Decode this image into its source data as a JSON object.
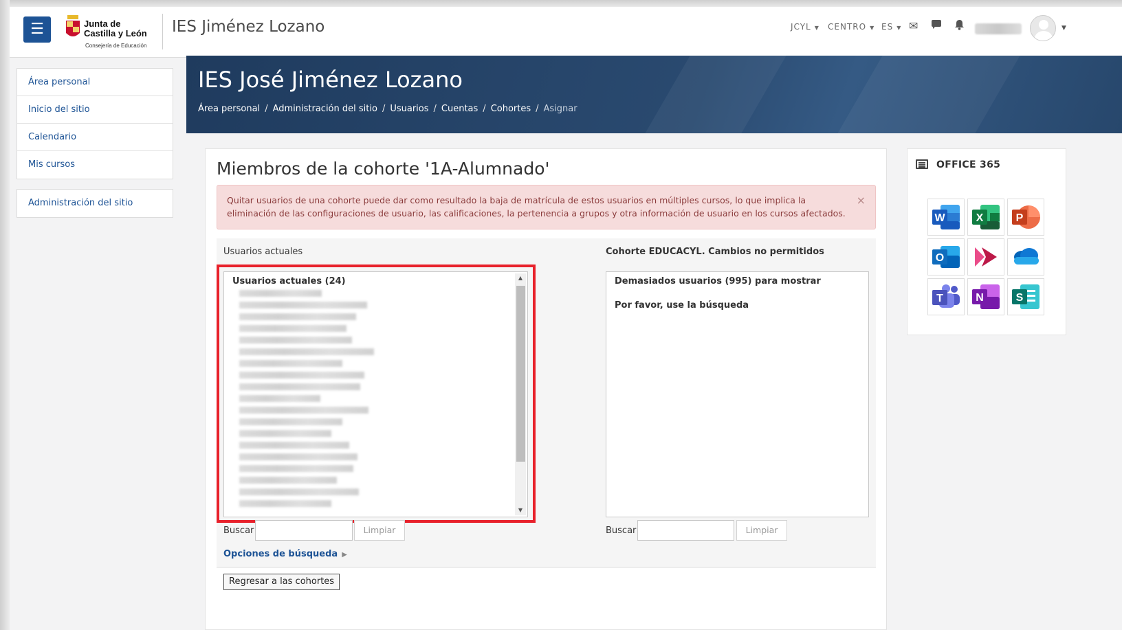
{
  "navbar": {
    "logo_line1": "Junta de",
    "logo_line2": "Castilla y León",
    "logo_line3": "Consejería de Educación",
    "site_name": "IES Jiménez Lozano",
    "menus": [
      {
        "label": "JCYL"
      },
      {
        "label": "CENTRO"
      },
      {
        "label": "ES"
      }
    ],
    "icons": [
      "menu-icon",
      "envelope-icon",
      "chat-icon",
      "bell-icon",
      "user-avatar-icon",
      "chevron-down-icon"
    ]
  },
  "sidebar": {
    "items": [
      {
        "label": "Área personal"
      },
      {
        "label": "Inicio del sitio"
      },
      {
        "label": "Calendario"
      },
      {
        "label": "Mis cursos"
      }
    ],
    "admin": {
      "label": "Administración del sitio"
    }
  },
  "header": {
    "title": "IES José Jiménez Lozano",
    "breadcrumb": [
      {
        "label": "Área personal"
      },
      {
        "label": "Administración del sitio"
      },
      {
        "label": "Usuarios"
      },
      {
        "label": "Cuentas"
      },
      {
        "label": "Cohortes"
      },
      {
        "label": "Asignar"
      }
    ],
    "breadcrumb_sep": "/"
  },
  "main": {
    "title": "Miembros de la cohorte '1A-Alumnado'",
    "alert": "Quitar usuarios de una cohorte puede dar como resultado la baja de matrícula de estos usuarios en múltiples cursos, lo que implica la eliminación de las configuraciones de usuario, las calificaciones, la pertenencia a grupos y otra información de usuario en los cursos afectados.",
    "alert_close": "×",
    "current": {
      "label": "Usuarios actuales",
      "list_header": "Usuarios actuales (24)",
      "search_label": "Buscar",
      "search_value": "",
      "clear_label": "Limpiar"
    },
    "potential": {
      "label": "Cohorte EDUCACYL. Cambios no permitidos",
      "message1": "Demasiados usuarios (995) para mostrar",
      "message2": "Por favor, use la búsqueda",
      "search_label": "Buscar",
      "search_value": "",
      "clear_label": "Limpiar"
    },
    "search_options": "Opciones de búsqueda",
    "back_button": "Regresar a las cohortes"
  },
  "office365": {
    "title": "OFFICE 365",
    "apps": [
      {
        "name": "word-icon",
        "letter": "W",
        "color": "#185abd"
      },
      {
        "name": "excel-icon",
        "letter": "X",
        "color": "#107c41"
      },
      {
        "name": "powerpoint-icon",
        "letter": "P",
        "color": "#c43e1c"
      },
      {
        "name": "outlook-icon",
        "letter": "O",
        "color": "#0f6cbd"
      },
      {
        "name": "stream-icon",
        "letter": "",
        "color": "#bc1948"
      },
      {
        "name": "onedrive-icon",
        "letter": "",
        "color": "#0f78d4"
      },
      {
        "name": "teams-icon",
        "letter": "T",
        "color": "#4b53bc"
      },
      {
        "name": "onenote-icon",
        "letter": "N",
        "color": "#7719aa"
      },
      {
        "name": "sway-icon",
        "letter": "S",
        "color": "#077568"
      }
    ]
  },
  "colors": {
    "brand": "#1d5395",
    "banner": "#2a4a70",
    "alert_bg": "#f6dcdc",
    "highlight": "#e8212b"
  }
}
